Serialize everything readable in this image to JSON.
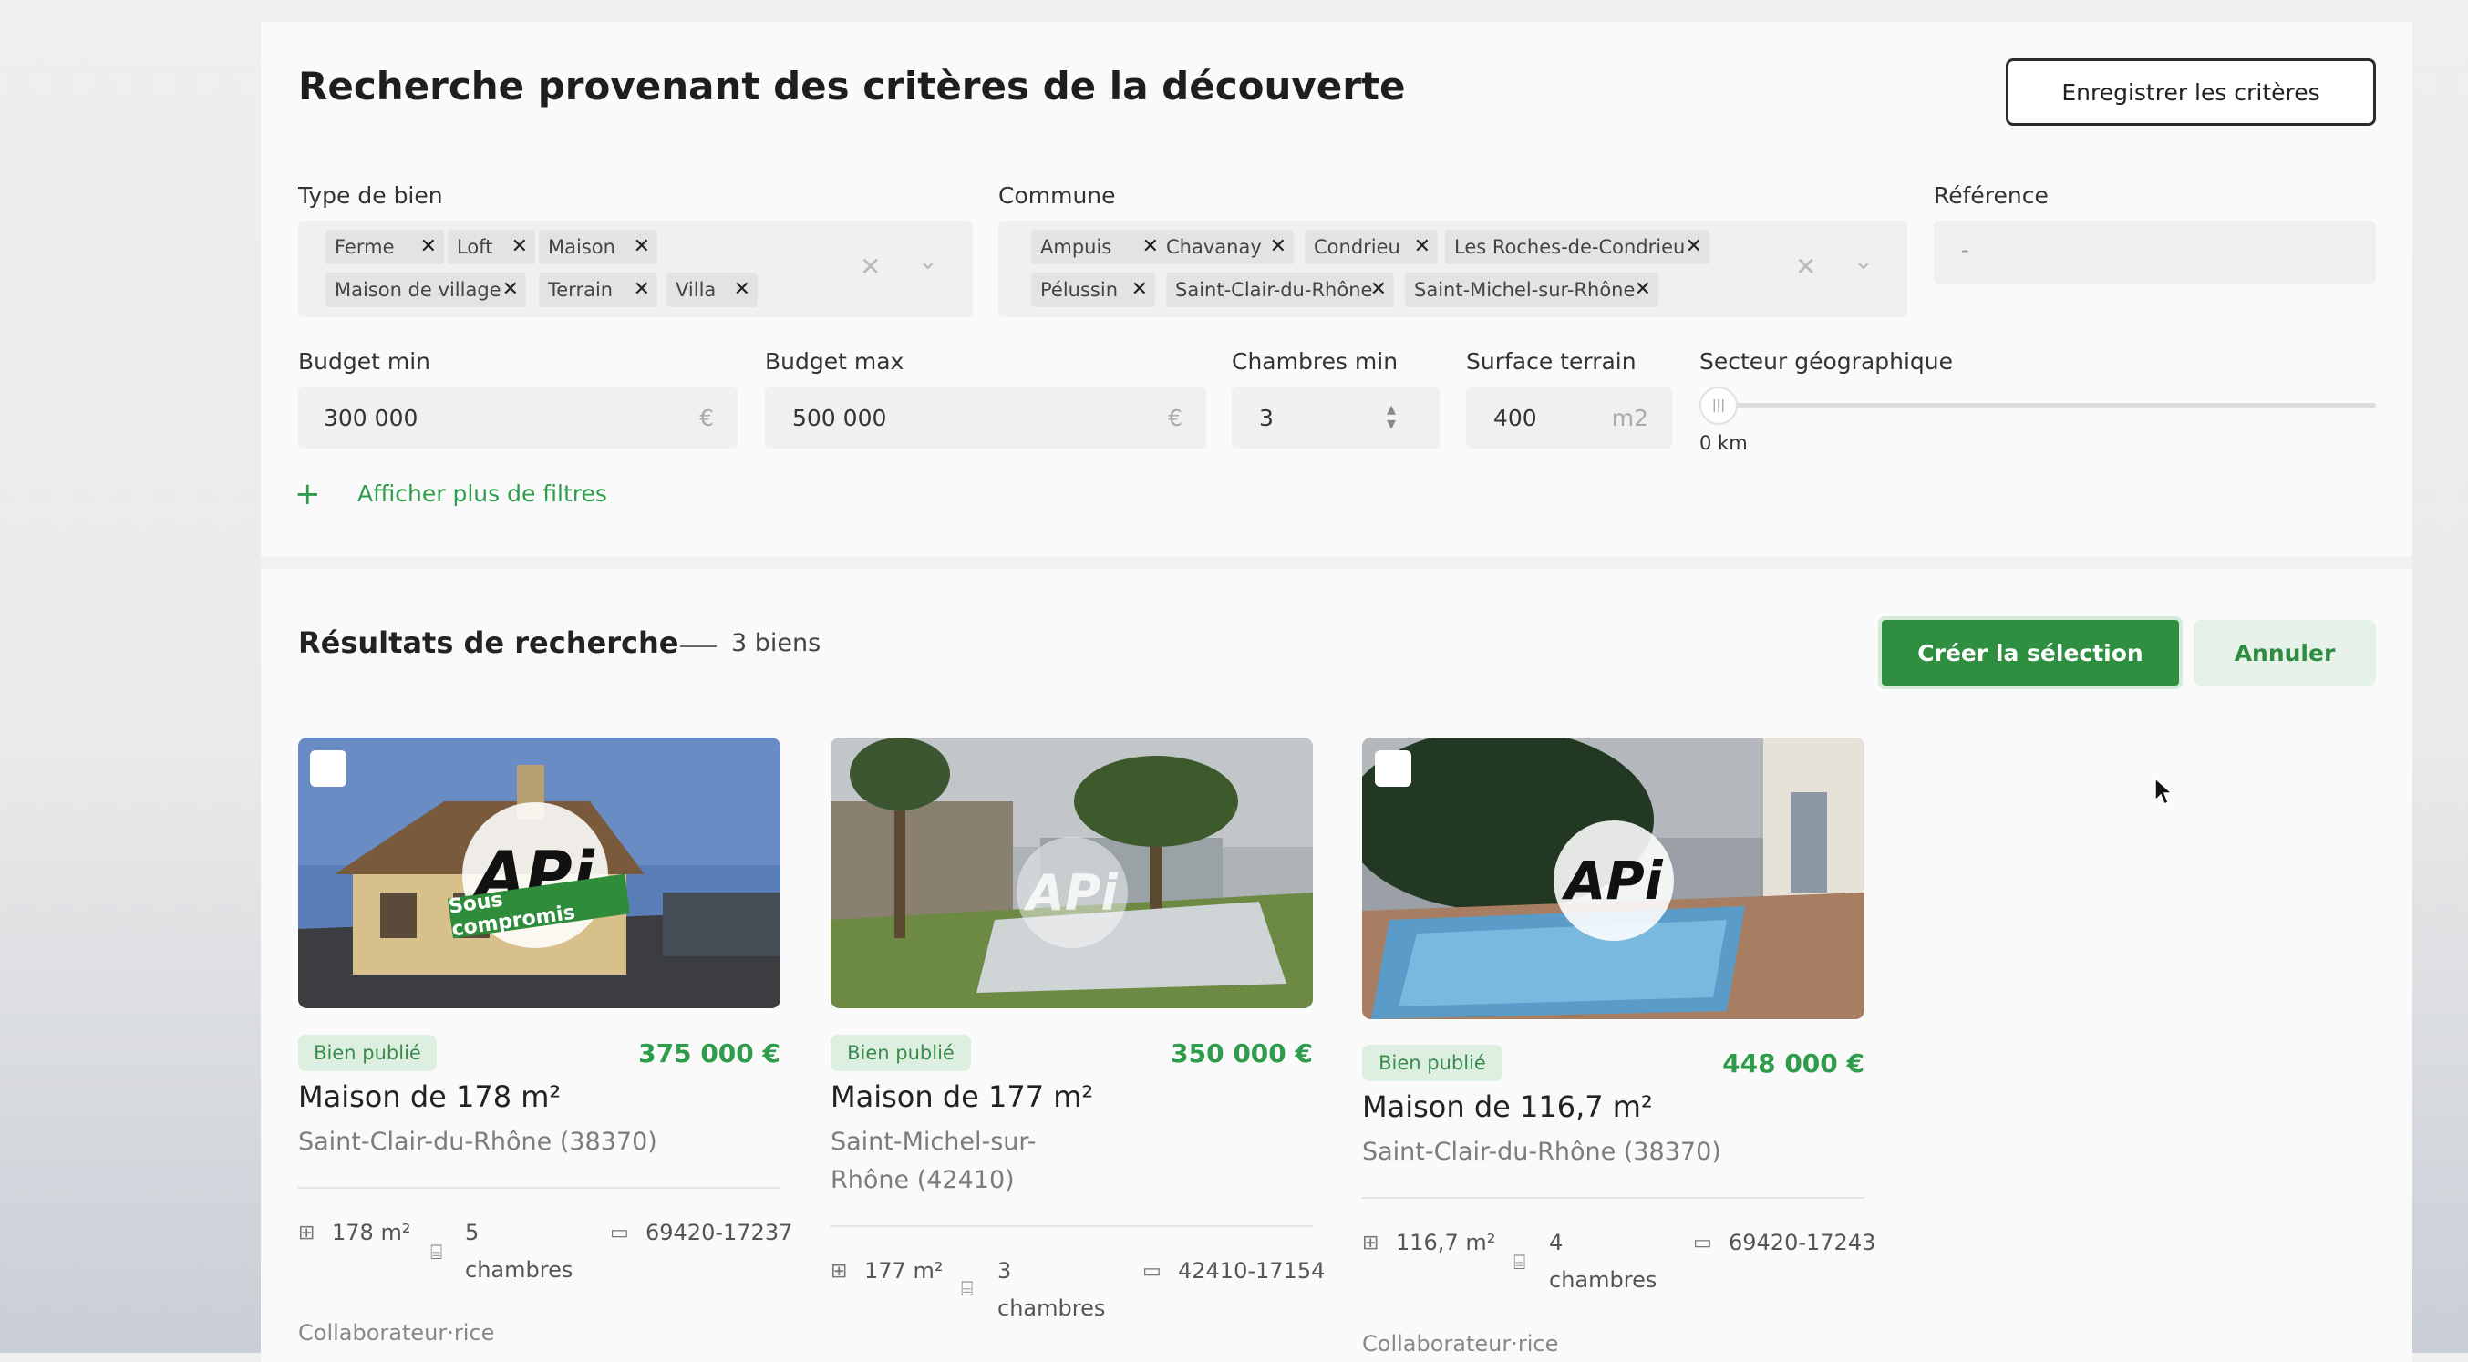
{
  "header": {
    "title": "Recherche provenant des critères de la découverte",
    "save_button": "Enregistrer les critères"
  },
  "filters": {
    "type_label": "Type de bien",
    "type_chips": [
      "Ferme",
      "Loft",
      "Maison",
      "Maison de village",
      "Terrain",
      "Villa"
    ],
    "commune_label": "Commune",
    "commune_chips": [
      "Ampuis",
      "Chavanay",
      "Condrieu",
      "Les Roches-de-Condrieu",
      "Pélussin",
      "Saint-Clair-du-Rhône",
      "Saint-Michel-sur-Rhône"
    ],
    "reference_label": "Référence",
    "reference_value": "-",
    "budget_min_label": "Budget min",
    "budget_min_value": "300 000",
    "budget_max_label": "Budget max",
    "budget_max_value": "500 000",
    "currency": "€",
    "rooms_label": "Chambres min",
    "rooms_value": "3",
    "surface_label": "Surface terrain",
    "surface_value": "400",
    "surface_unit": "m2",
    "sector_label": "Secteur géographique",
    "sector_value": "0 km",
    "sector_level": 0,
    "more_filters": "Afficher plus de filtres"
  },
  "results": {
    "title": "Résultats de recherche",
    "count": "3 biens",
    "create_button": "Créer la sélection",
    "cancel_button": "Annuler"
  },
  "cards": [
    {
      "badge": "Bien publié",
      "price": "375 000 €",
      "title": "Maison de 178 m²",
      "location": "Saint-Clair-du-Rhône (38370)",
      "surface": "178 m²",
      "rooms": "5 chambres",
      "ref": "69420-17237",
      "collab": "Collaborateur·rice",
      "logo": "APi",
      "overlay": "Sous compromis"
    },
    {
      "badge": "Bien publié",
      "price": "350 000 €",
      "title": "Maison de 177 m²",
      "location": "Saint-Michel-sur-Rhône (42410)",
      "surface": "177 m²",
      "rooms": "3 chambres",
      "ref": "42410-17154",
      "logo": "APi"
    },
    {
      "badge": "Bien publié",
      "price": "448 000 €",
      "title": "Maison de 116,7 m²",
      "location": "Saint-Clair-du-Rhône (38370)",
      "surface": "116,7 m²",
      "rooms": "4 chambres",
      "ref": "69420-17243",
      "collab": "Collaborateur·rice",
      "logo": "APi"
    }
  ],
  "icons": [
    "close-icon",
    "chevron-down-icon",
    "plus-icon",
    "surface-icon",
    "bed-icon",
    "reference-icon",
    "cursor-icon",
    "stepper-icon",
    "slider-handle-icon"
  ],
  "colors": {
    "accent": "#2d8f3f",
    "accent_text": "#2f9c4c",
    "badge_bg": "#dcefe0"
  }
}
